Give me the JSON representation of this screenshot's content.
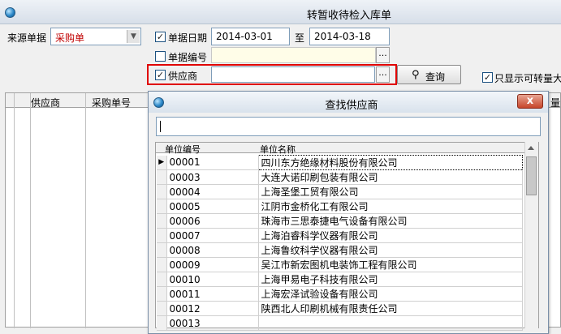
{
  "window": {
    "title": "转暂收待检入库单"
  },
  "form": {
    "source_label": "来源单据",
    "source_value": "采购单",
    "date_label": "单据日期",
    "date_from": "2014-03-01",
    "date_to_label": "至",
    "date_to": "2014-03-18",
    "docno_label": "单据编号",
    "supplier_label": "供应商",
    "supplier_value": "",
    "ellipsis": "...",
    "query_label": "查询",
    "only_show_label": "只显示可转量大"
  },
  "grid": {
    "columns": [
      "供应商",
      "采购单号"
    ],
    "partial_right_col": "量"
  },
  "dialog": {
    "title": "查找供应商",
    "close": "x",
    "search_value": "",
    "columns": {
      "code": "单位编号",
      "name": "单位名称"
    },
    "rows": [
      {
        "code": "00001",
        "name": "四川东方绝缘材料股份有限公司"
      },
      {
        "code": "00003",
        "name": "大连大诺印刷包装有限公司"
      },
      {
        "code": "00004",
        "name": "上海圣堡工贸有限公司"
      },
      {
        "code": "00005",
        "name": "江阴市金桥化工有限公司"
      },
      {
        "code": "00006",
        "name": "珠海市三思泰捷电气设备有限公司"
      },
      {
        "code": "00007",
        "name": "上海泊睿科学仪器有限公司"
      },
      {
        "code": "00008",
        "name": "上海鲁纹科学仪器有限公司"
      },
      {
        "code": "00009",
        "name": "吴江市新宏图机电装饰工程有限公司"
      },
      {
        "code": "00010",
        "name": "上海甲易电子科技有限公司"
      },
      {
        "code": "00011",
        "name": "上海宏泽试验设备有限公司"
      },
      {
        "code": "00012",
        "name": "陕西北人印刷机械有限责任公司"
      },
      {
        "code": "00013",
        "name": ""
      }
    ]
  }
}
